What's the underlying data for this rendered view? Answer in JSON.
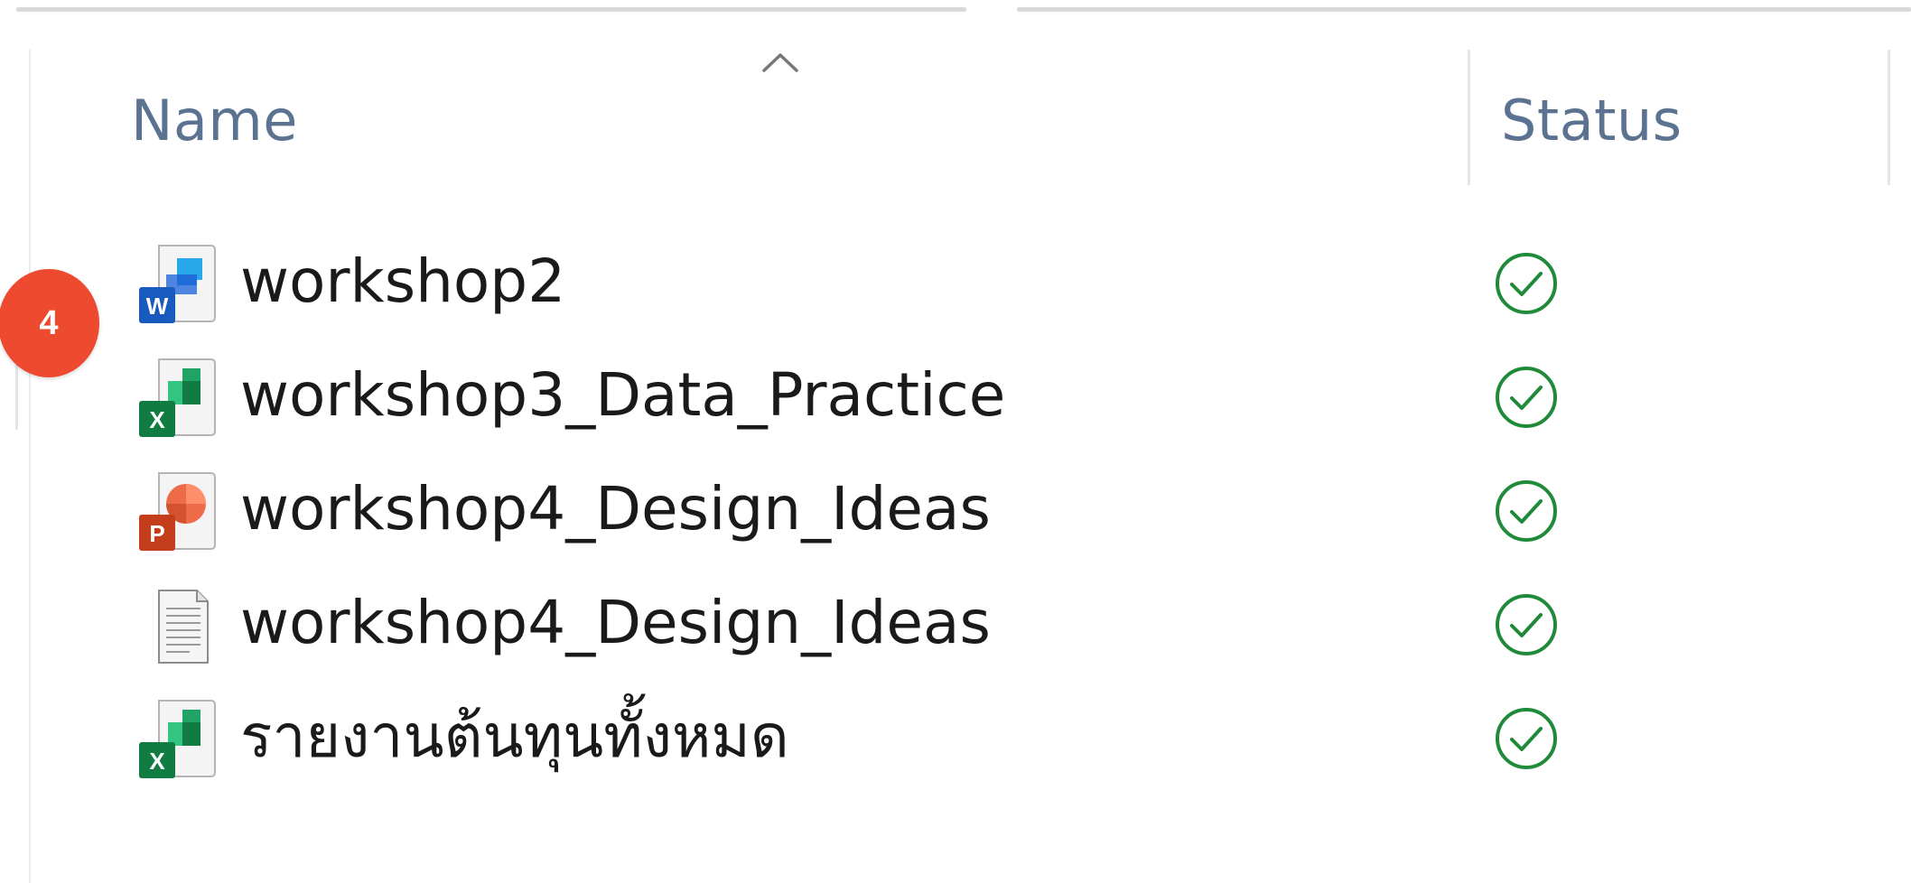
{
  "header": {
    "name_label": "Name",
    "status_label": "Status",
    "sort_icon": "chevron-up-icon"
  },
  "files": [
    {
      "name": "workshop2",
      "type": "word",
      "icon": "word-doc-icon",
      "status": "synced",
      "status_icon": "check-circle-icon"
    },
    {
      "name": "workshop3_Data_Practice",
      "type": "excel",
      "icon": "excel-doc-icon",
      "status": "synced",
      "status_icon": "check-circle-icon"
    },
    {
      "name": "workshop4_Design_Ideas",
      "type": "powerpoint",
      "icon": "powerpoint-doc-icon",
      "status": "synced",
      "status_icon": "check-circle-icon"
    },
    {
      "name": "workshop4_Design_Ideas",
      "type": "text",
      "icon": "text-doc-icon",
      "status": "synced",
      "status_icon": "check-circle-icon"
    },
    {
      "name": "รายงานต้นทุนทั้งหมด",
      "type": "excel",
      "icon": "excel-doc-icon",
      "status": "synced",
      "status_icon": "check-circle-icon"
    }
  ],
  "badge": {
    "label": "4",
    "color": "#ee4a2f"
  },
  "colors": {
    "header_text": "#5b7391",
    "status_green": "#1f8a3a",
    "word_blue": "#185abd",
    "excel_green": "#107c41",
    "powerpoint_red": "#c43e1c"
  }
}
